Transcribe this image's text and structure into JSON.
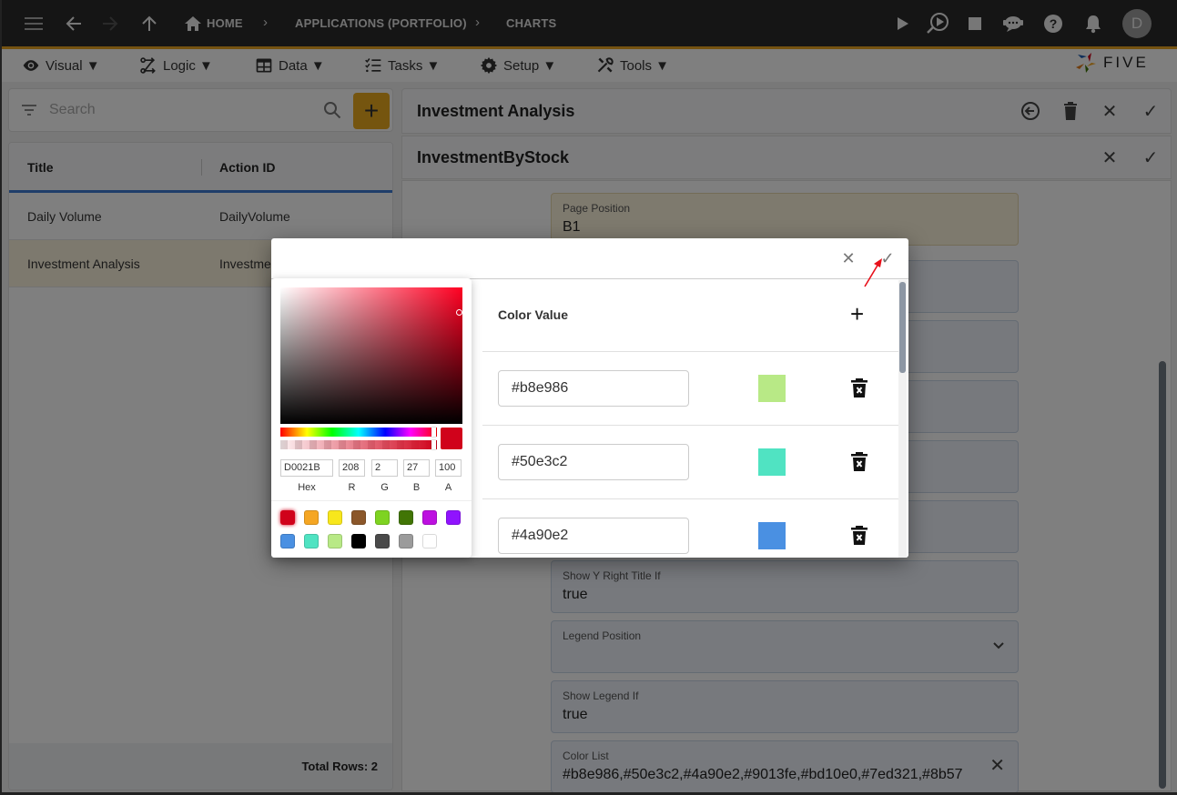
{
  "topbar": {
    "breadcrumbs": [
      "HOME",
      "APPLICATIONS (PORTFOLIO)",
      "CHARTS"
    ],
    "icons": [
      "menu-icon",
      "back-icon",
      "forward-icon",
      "up-icon",
      "home-icon",
      "play-icon",
      "debug-icon",
      "stop-icon",
      "chat-icon",
      "help-icon",
      "bell-icon"
    ],
    "avatar_initial": "D",
    "accent": "#e9a521"
  },
  "menubar": {
    "items": [
      {
        "label": "Visual ▼",
        "icon": "eye-icon"
      },
      {
        "label": "Logic ▼",
        "icon": "logic-icon"
      },
      {
        "label": "Data ▼",
        "icon": "table-icon"
      },
      {
        "label": "Tasks ▼",
        "icon": "tasks-icon"
      },
      {
        "label": "Setup ▼",
        "icon": "gear-icon"
      },
      {
        "label": "Tools ▼",
        "icon": "tools-icon"
      }
    ],
    "logo_text": "FIVE"
  },
  "left": {
    "search_placeholder": "Search",
    "add_label": "+",
    "columns": [
      "Title",
      "Action ID"
    ],
    "rows": [
      {
        "title": "Daily Volume",
        "action_id": "DailyVolume",
        "selected": false
      },
      {
        "title": "Investment Analysis",
        "action_id": "InvestmentAnalysis",
        "selected": true
      }
    ],
    "total_rows": "Total Rows: 2"
  },
  "right": {
    "header_title": "Investment Analysis",
    "subheader_title": "InvestmentByStock",
    "fields": [
      {
        "label": "Page Position",
        "value": "B1",
        "style": "gold"
      },
      {
        "label": "Show Y Right Title If",
        "value": "true"
      },
      {
        "label": "Legend Position",
        "value": "",
        "dropdown": true
      },
      {
        "label": "Show Legend If",
        "value": "true"
      },
      {
        "label": "Color List",
        "value": "#b8e986,#50e3c2,#4a90e2,#9013fe,#bd10e0,#7ed321,#8b57",
        "clearable": true
      }
    ]
  },
  "dialog": {
    "list_header": "Color Value",
    "colors": [
      {
        "value": "#b8e986",
        "swatch": "#b8e986"
      },
      {
        "value": "#50e3c2",
        "swatch": "#50e3c2"
      },
      {
        "value": "#4a90e2",
        "swatch": "#4a90e2"
      }
    ]
  },
  "picker": {
    "hex": "D0021B",
    "r": "208",
    "g": "2",
    "b": "27",
    "a": "100",
    "labels": [
      "Hex",
      "R",
      "G",
      "B",
      "A"
    ],
    "current_color": "#d0021b",
    "presets": [
      "#d0021b",
      "#f5a623",
      "#f8e71c",
      "#8b572a",
      "#7ed321",
      "#417505",
      "#bd10e0",
      "#9013fe",
      "#4a90e2",
      "#50e3c2",
      "#b8e986",
      "#000000",
      "#4a4a4a",
      "#9b9b9b",
      "#ffffff"
    ]
  }
}
